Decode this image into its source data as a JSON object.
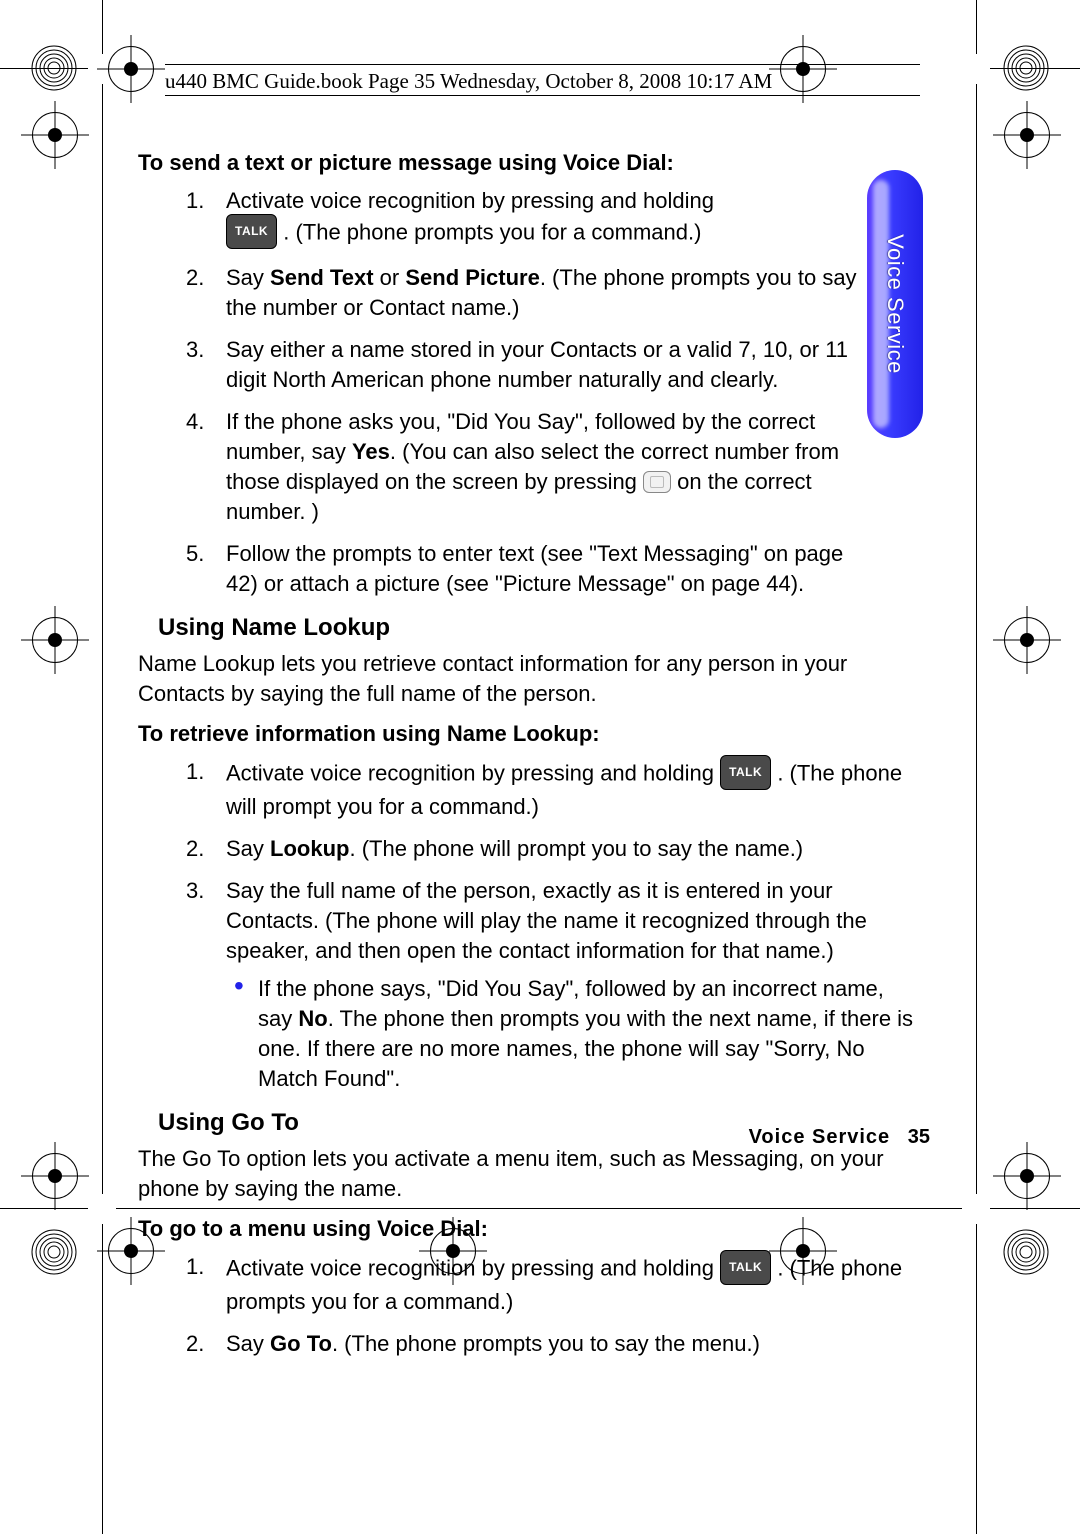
{
  "running_head": "u440 BMC Guide.book  Page 35  Wednesday, October 8, 2008  10:17 AM",
  "side_tab": "Voice Service",
  "footer": {
    "section": "Voice Service",
    "page": "35"
  },
  "icons": {
    "talk": "TALK"
  },
  "section1": {
    "heading": "To send a text or picture message using Voice Dial:",
    "steps": {
      "s1a": "Activate voice recognition by pressing and holding ",
      "s1b": ". (The phone prompts you for a command.)",
      "s2a": "Say ",
      "s2b1": "Send Text",
      "s2c": " or ",
      "s2b2": "Send Picture",
      "s2d": ". (The phone prompts you to say the number or Contact name.)",
      "s3": "Say either a name stored in your Contacts or a valid 7, 10, or 11 digit North American phone number naturally and clearly.",
      "s4a": "If the phone asks you, \"Did You Say\", followed by the correct number, say ",
      "s4b": "Yes",
      "s4c": ". (You can also select the correct number from those displayed on the screen by pressing ",
      "s4d": " on the correct number. )",
      "s5": "Follow the prompts to enter text (see \"Text Messaging\" on page 42) or attach a picture (see \"Picture Message\" on page 44)."
    }
  },
  "name_lookup": {
    "heading": "Using Name Lookup",
    "para": "Name Lookup lets you retrieve contact information for any person in your Contacts by saying the full name of the person.",
    "sub": "To retrieve information using Name Lookup:",
    "steps": {
      "s1a": "Activate voice recognition by pressing and holding ",
      "s1b": ". (The phone will prompt you for a command.)",
      "s2a": "Say ",
      "s2b": "Lookup",
      "s2c": ". (The phone will prompt you to say the name.)",
      "s3": "Say the full name of the person, exactly as it is entered in your Contacts. (The phone will play the name it recognized through the speaker, and then open the contact information for that name.)",
      "bullet_a": "If the phone says, \"Did You Say\", followed by an incorrect name, say ",
      "bullet_b": "No",
      "bullet_c": ". The phone then prompts you with the next name, if there is one. If there are no more names, the phone will say \"Sorry, No Match Found\"."
    }
  },
  "goto": {
    "heading": "Using Go To",
    "para": "The Go To option lets you activate a menu item, such as Messaging, on your phone by saying the name.",
    "sub": "To go to a menu using Voice Dial:",
    "steps": {
      "s1a": "Activate voice recognition by pressing and holding ",
      "s1b": ". (The phone prompts you for a command.)",
      "s2a": "Say ",
      "s2b": "Go To",
      "s2c": ". (The phone prompts you to say the menu.)"
    }
  }
}
